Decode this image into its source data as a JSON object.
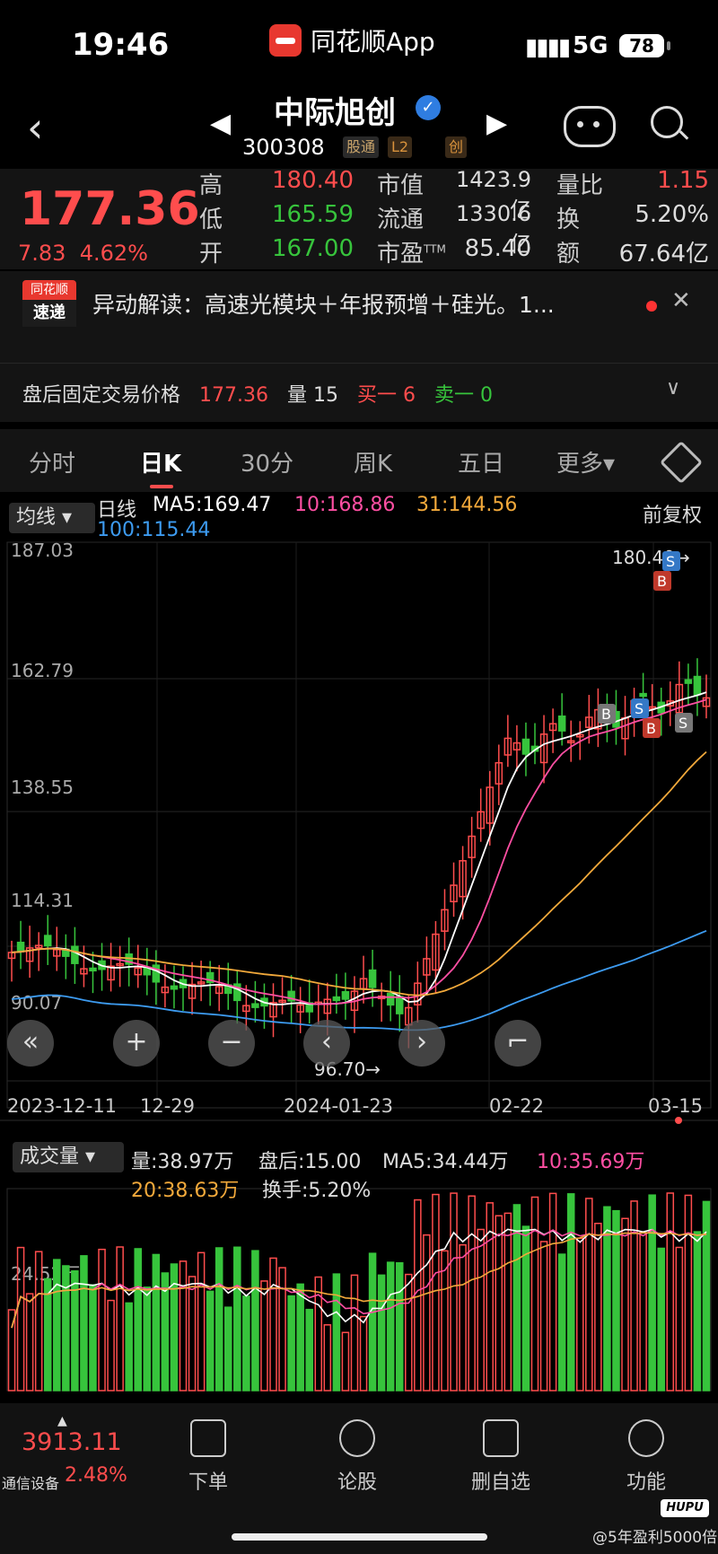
{
  "status_bar": {
    "time": "19:46",
    "app_name": "同花顺App",
    "signal": "▮▮▮▮",
    "network": "5G",
    "battery": "78"
  },
  "header": {
    "back_icon": "chevron-left-icon",
    "stock_name": "中际旭创",
    "stock_code": "300308",
    "tags": [
      "股通",
      "L2",
      "创"
    ]
  },
  "quote": {
    "price": "177.36",
    "change": "7.83",
    "change_pct": "4.62%",
    "labels": {
      "high": "高",
      "low": "低",
      "open": "开",
      "mktcap": "市值",
      "float": "流通",
      "pe": "市盈",
      "pe_sup": "TTM",
      "vol_ratio": "量比",
      "turnover": "换",
      "amount": "额"
    },
    "high": "180.40",
    "low": "165.59",
    "open": "167.00",
    "mktcap": "1423.9亿",
    "float": "1330.6亿",
    "pe": "85.40",
    "vol_ratio": "1.15",
    "turnover": "5.20%",
    "amount": "67.64亿"
  },
  "news": {
    "logo_top": "同花顺",
    "logo_bottom": "速递",
    "text": "异动解读：高速光模块＋年报预增＋硅光。1...",
    "after_hours": {
      "label": "盘后固定交易价格",
      "price": "177.36",
      "vol_label": "量",
      "vol": "15",
      "buy_label": "买一",
      "buy": "6",
      "sell_label": "卖一",
      "sell": "0"
    }
  },
  "tabs": [
    "分时",
    "日K",
    "30分",
    "周K",
    "五日",
    "更多▾"
  ],
  "kline": {
    "ma_button": "均线",
    "ma_line_label": "日线",
    "ma5": "MA5:169.47",
    "ma10": "10:168.86",
    "ma31": "31:144.56",
    "ma100": "100:115.44",
    "adjust": "前复权",
    "y_ticks": [
      "187.03",
      "162.79",
      "138.55",
      "114.31",
      "90.07"
    ],
    "high_mark": "180.40→",
    "low_mark": "96.70→",
    "dates": [
      "2023-12-11",
      "12-29",
      "2024-01-23",
      "02-22",
      "03-15"
    ],
    "signals": [
      "S",
      "B",
      "B",
      "S",
      "B",
      "S"
    ]
  },
  "nav_controls": [
    "«",
    "+",
    "−",
    "‹",
    "›",
    "⌐"
  ],
  "volume": {
    "button": "成交量",
    "vol": "量:38.97万",
    "after": "盘后:15.00",
    "ma5": "MA5:34.44万",
    "ma10": "10:35.69万",
    "ma20": "20:38.63万",
    "turnover": "换手:5.20%",
    "y_tick": "24.52万"
  },
  "bottom": {
    "index_value": "3913.11",
    "index_name": "通信设备",
    "index_pct": "2.48%",
    "nav": [
      {
        "label": "下单",
        "icon": "order-icon"
      },
      {
        "label": "论股",
        "icon": "discussion-icon"
      },
      {
        "label": "删自选",
        "icon": "remove-watchlist-icon"
      },
      {
        "label": "功能",
        "icon": "menu-icon"
      }
    ]
  },
  "watermark": {
    "brand": "HUPU",
    "text": "@5年盈利5000倍"
  },
  "colors": {
    "up": "#ff4d4d",
    "down": "#37c43c",
    "ma5": "#ffffff",
    "ma10": "#ff4fa3",
    "ma31": "#f2a93b",
    "ma100": "#3d9bf0"
  }
}
